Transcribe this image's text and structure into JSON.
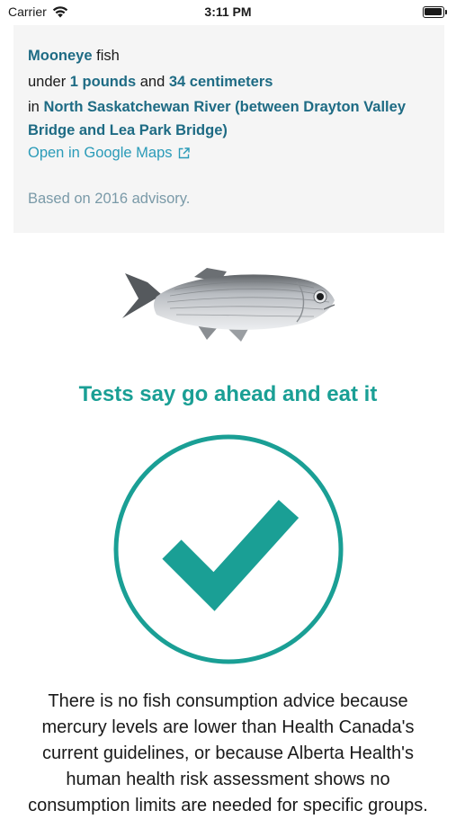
{
  "status_bar": {
    "carrier": "Carrier",
    "time": "3:11 PM"
  },
  "info": {
    "species": "Mooneye",
    "species_suffix": "fish",
    "under_label": "under",
    "weight": "1 pounds",
    "and_label": "and",
    "length": "34 centimeters",
    "in_label": "in",
    "location": "North Saskatchewan River (between Drayton Valley Bridge and Lea Park Bridge)",
    "maps_link": "Open in Google Maps",
    "advisory_note": "Based on 2016 advisory."
  },
  "verdict": {
    "heading": "Tests say go ahead and eat it",
    "explanation": "There is no fish consumption advice because mercury levels are lower than Health Canada's current guidelines, or because Alberta Health's human health risk assessment shows no consumption limits are needed for specific groups."
  },
  "colors": {
    "accent_teal": "#1a9f95",
    "link_blue": "#2a9bb8",
    "highlight_blue": "#1e6b84",
    "card_bg": "#f5f5f5"
  },
  "icons": {
    "wifi": "wifi-icon",
    "battery": "battery-icon",
    "external_link": "external-link-icon",
    "checkmark": "check-circle-icon"
  }
}
